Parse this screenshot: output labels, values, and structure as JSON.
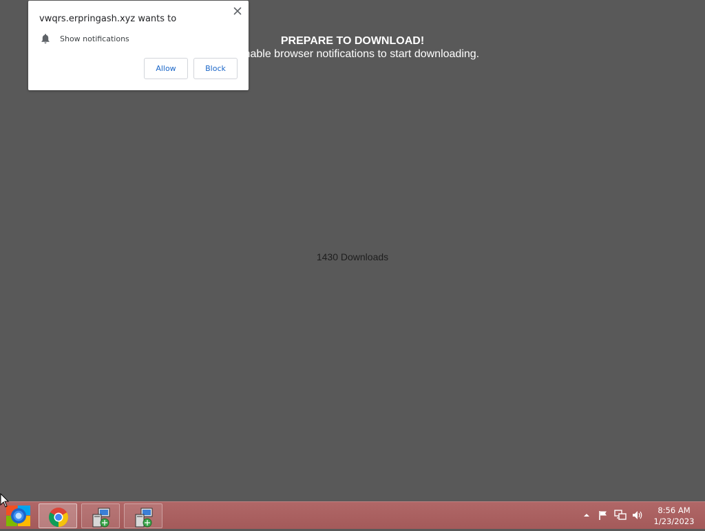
{
  "page": {
    "headline": "PREPARE TO DOWNLOAD!",
    "subline": "to enable browser notifications to start downloading.",
    "download_count": "1430 Downloads"
  },
  "permission_popup": {
    "title": "vwqrs.erpringash.xyz wants to",
    "permission_label": "Show notifications",
    "permission_icon": "bell-icon",
    "allow_label": "Allow",
    "block_label": "Block",
    "close_icon": "close-icon"
  },
  "taskbar": {
    "start_icon": "windows-start-orb-icon",
    "buttons": [
      {
        "icon": "chrome-icon",
        "active": true
      },
      {
        "icon": "network-computer-icon",
        "active": false
      },
      {
        "icon": "network-computer-icon",
        "active": false
      }
    ],
    "tray": {
      "icons": [
        "show-hidden-icons-arrow",
        "flag-icon",
        "network-icon",
        "volume-icon"
      ],
      "time": "8:56 AM",
      "date": "1/23/2023"
    }
  },
  "colors": {
    "background": "#595959",
    "taskbar": "#a85e5e",
    "link_blue": "#1a66c8"
  }
}
